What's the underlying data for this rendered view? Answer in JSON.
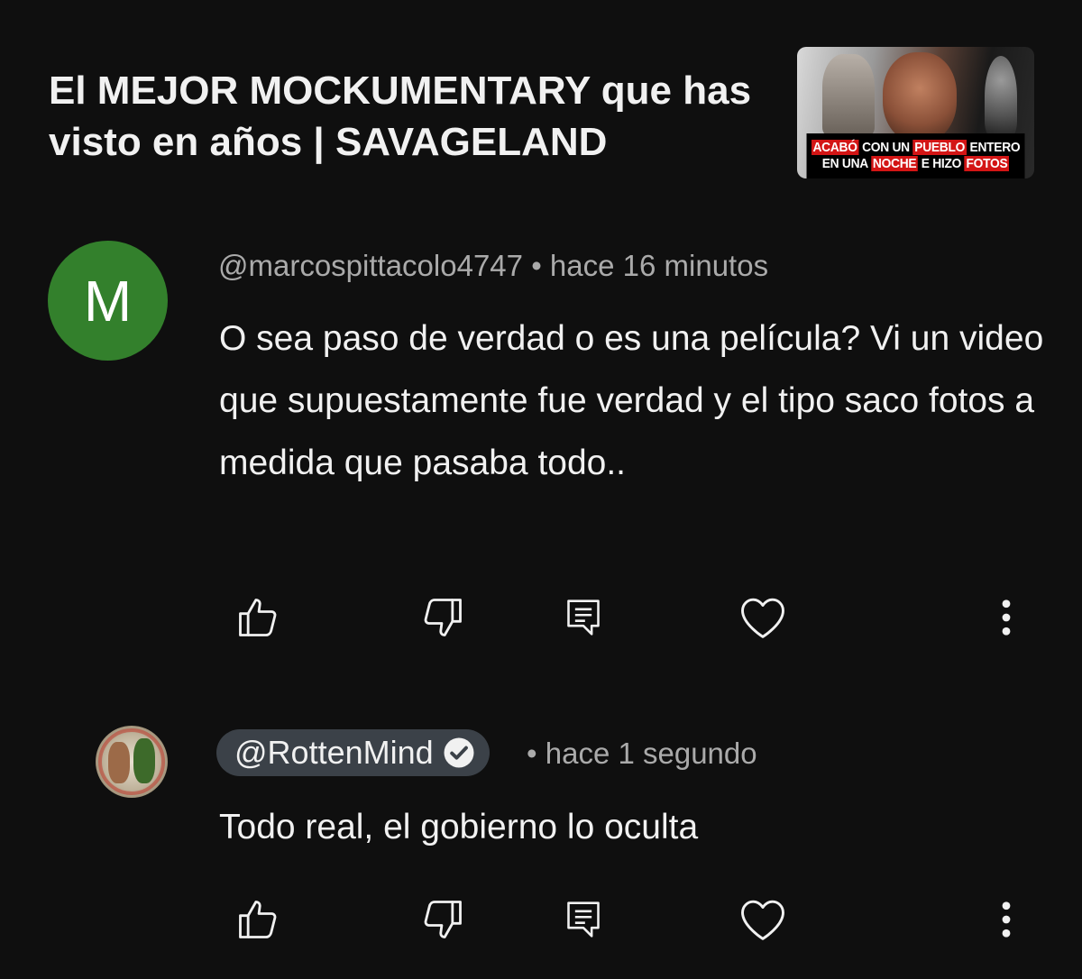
{
  "video": {
    "title": "El MEJOR MOCKUMENTARY que has visto en años | SAVAGELAND",
    "thumbnail_caption_line1": [
      "ACABÓ",
      " CON UN ",
      "PUEBLO",
      " ENTERO"
    ],
    "thumbnail_caption_line2": [
      "EN UNA ",
      "NOCHE",
      " E HIZO ",
      "FOTOS"
    ]
  },
  "comment": {
    "avatar_letter": "M",
    "author": "@marcospittacolo4747",
    "separator": "•",
    "time": "hace 16 minutos",
    "text": "O sea paso de verdad o es una película? Vi un video que supuestamente fue verdad y el tipo saco fotos a medida que pasaba todo..",
    "actions": [
      "like-icon",
      "dislike-icon",
      "reply-icon",
      "heart-icon",
      "more-vert-icon"
    ]
  },
  "reply": {
    "author": "@RottenMind",
    "verified": true,
    "separator": "•",
    "time": "hace 1 segundo",
    "text": "Todo real, el gobierno lo oculta",
    "actions": [
      "like-icon",
      "dislike-icon",
      "reply-icon",
      "heart-icon",
      "more-vert-icon"
    ]
  },
  "colors": {
    "background": "#0f0f0f",
    "avatar_green": "#33802c",
    "meta_gray": "#aaaaaa",
    "pill_bg": "#3b4148",
    "thumbnail_red": "#d31515"
  }
}
